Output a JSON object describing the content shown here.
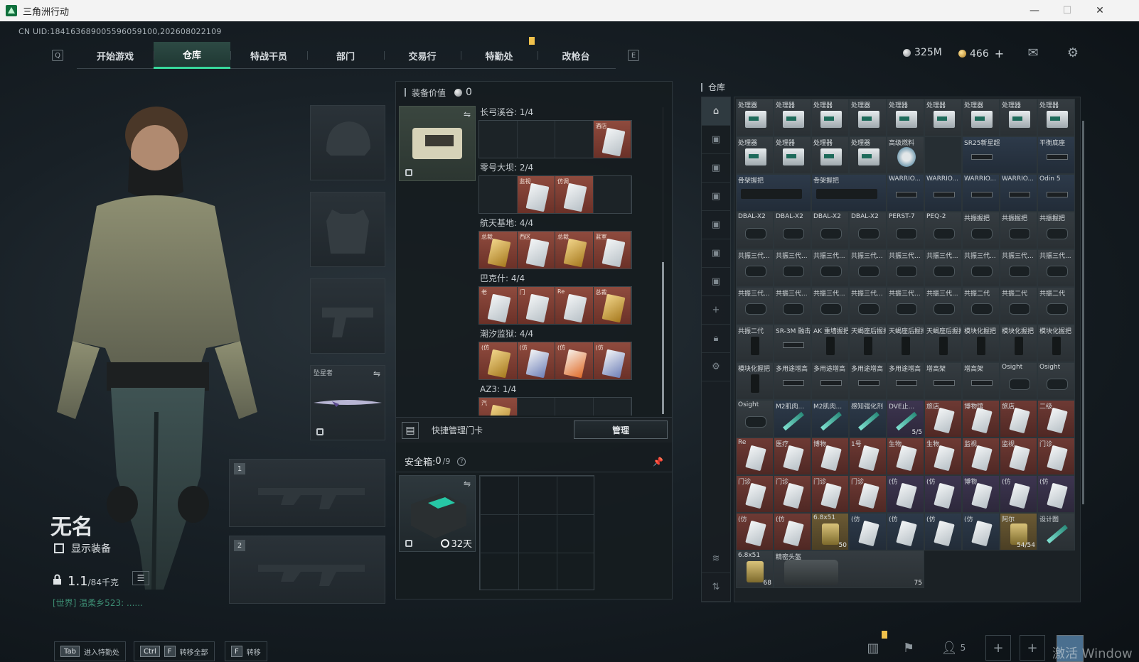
{
  "window": {
    "title": "三角洲行动",
    "minimize": "—",
    "maximize": "☐",
    "close": "✕"
  },
  "uid": "CN UID:184163689005596059100,202608022109",
  "nav": {
    "left_key": "Q",
    "right_key": "E",
    "tabs": [
      "开始游戏",
      "仓库",
      "特战干员",
      "部门",
      "交易行",
      "特勤处",
      "改枪台"
    ],
    "active_tab": "仓库"
  },
  "currency": {
    "silver": "325M",
    "gold": "466",
    "gold_add": "+"
  },
  "player": {
    "name": "无名",
    "show_equipment": "显示装备",
    "weight_value": "1.1",
    "weight_max": "/84千克",
    "chat": "[世界] 温柔乡523: ......"
  },
  "slots": {
    "melee_label": "坠星者",
    "primary_1": "1",
    "primary_2": "2"
  },
  "equipment": {
    "title": "装备价值",
    "value": "0",
    "maps": [
      {
        "label": "长弓溪谷: 1/4",
        "cells": [
          {
            "state": "empty"
          },
          {
            "state": "empty"
          },
          {
            "state": "empty"
          },
          {
            "state": "filled",
            "cap": "酒店",
            "tint": "white"
          }
        ]
      },
      {
        "label": "零号大坝: 2/4",
        "cells": [
          {
            "state": "empty"
          },
          {
            "state": "filled",
            "cap": "监视",
            "tint": "white"
          },
          {
            "state": "filled",
            "cap": "仿调",
            "tint": "white"
          },
          {
            "state": "empty"
          }
        ]
      },
      {
        "label": "航天基地: 4/4",
        "cells": [
          {
            "state": "filled",
            "cap": "总裁",
            "tint": "gold"
          },
          {
            "state": "filled",
            "cap": "西区",
            "tint": "white"
          },
          {
            "state": "filled",
            "cap": "总裁",
            "tint": "gold"
          },
          {
            "state": "filled",
            "cap": "蓝室",
            "tint": "white"
          }
        ]
      },
      {
        "label": "巴克什: 4/4",
        "cells": [
          {
            "state": "filled",
            "cap": "老",
            "tint": "white"
          },
          {
            "state": "filled",
            "cap": "门",
            "tint": "white"
          },
          {
            "state": "filled",
            "cap": "Re",
            "tint": "white"
          },
          {
            "state": "filled",
            "cap": "总裁",
            "tint": "gold"
          }
        ]
      },
      {
        "label": "潮汐监狱: 4/4",
        "cells": [
          {
            "state": "filled",
            "cap": "(仿",
            "tint": "gold"
          },
          {
            "state": "filled",
            "cap": "(仿",
            "tint": "blue"
          },
          {
            "state": "filled",
            "cap": "(仿",
            "tint": "orange"
          },
          {
            "state": "filled",
            "cap": "(仿",
            "tint": "blue"
          }
        ]
      },
      {
        "label": "AZ3: 1/4",
        "cells": [
          {
            "state": "filled",
            "cap": "汽",
            "tint": "gold"
          },
          {
            "state": "empty"
          },
          {
            "state": "empty"
          },
          {
            "state": "empty"
          }
        ]
      }
    ],
    "quick_card_label": "快捷管理门卡",
    "manage_button": "管理",
    "safebox_label": "安全箱: ",
    "safebox_count": "0",
    "safebox_max": "/9",
    "safebox_help": "?",
    "safebox_days": "32天"
  },
  "warehouse": {
    "title": "仓库",
    "items": [
      {
        "nm": "处理器",
        "g": "box",
        "c": "gray"
      },
      {
        "nm": "处理器",
        "g": "box",
        "c": "gray"
      },
      {
        "nm": "处理器",
        "g": "box",
        "c": "gray"
      },
      {
        "nm": "处理器",
        "g": "box",
        "c": "gray"
      },
      {
        "nm": "处理器",
        "g": "box",
        "c": "gray"
      },
      {
        "nm": "处理器",
        "g": "box",
        "c": "gray"
      },
      {
        "nm": "处理器",
        "g": "box",
        "c": "gray"
      },
      {
        "nm": "处理器",
        "g": "box",
        "c": "gray"
      },
      {
        "nm": "处理器",
        "g": "box",
        "c": "gray"
      },
      {
        "nm": "处理器",
        "g": "box",
        "c": "gray"
      },
      {
        "nm": "处理器",
        "g": "box",
        "c": "gray"
      },
      {
        "nm": "处理器",
        "g": "box",
        "c": "gray"
      },
      {
        "nm": "处理器",
        "g": "box",
        "c": "gray"
      },
      {
        "nm": "高级燃料",
        "g": "fuel",
        "c": "gray"
      },
      {
        "nm": "",
        "g": "",
        "c": ""
      },
      {
        "nm": "SR25新星超长枪管",
        "g": "rail",
        "c": "blue",
        "span": 2
      },
      {
        "nm": "平衡底座",
        "g": "rail",
        "c": "blue"
      },
      {
        "nm": "骨架握把",
        "g": "rifle",
        "c": "blue",
        "span": 2
      },
      {
        "nm": "骨架握把",
        "g": "rifle",
        "c": "blue",
        "span": 2
      },
      {
        "nm": "WARRIO...",
        "g": "rail",
        "c": "blue"
      },
      {
        "nm": "WARRIO...",
        "g": "rail",
        "c": "blue"
      },
      {
        "nm": "WARRIO...",
        "g": "rail",
        "c": "blue"
      },
      {
        "nm": "WARRIO...",
        "g": "rail",
        "c": "blue"
      },
      {
        "nm": "Odin 5",
        "g": "rail",
        "c": "blue"
      },
      {
        "nm": "DBAL-X2",
        "g": "scope",
        "c": "gray"
      },
      {
        "nm": "DBAL-X2",
        "g": "scope",
        "c": "gray"
      },
      {
        "nm": "DBAL-X2",
        "g": "scope",
        "c": "gray"
      },
      {
        "nm": "DBAL-X2",
        "g": "scope",
        "c": "gray"
      },
      {
        "nm": "PERST-7",
        "g": "scope",
        "c": "gray"
      },
      {
        "nm": "PEQ-2",
        "g": "scope",
        "c": "gray"
      },
      {
        "nm": "共振握把",
        "g": "scope",
        "c": "gray"
      },
      {
        "nm": "共振握把",
        "g": "scope",
        "c": "gray"
      },
      {
        "nm": "共振握把",
        "g": "scope",
        "c": "gray"
      },
      {
        "nm": "共振三代...",
        "g": "scope",
        "c": "gray"
      },
      {
        "nm": "共振三代...",
        "g": "scope",
        "c": "gray"
      },
      {
        "nm": "共振三代...",
        "g": "scope",
        "c": "gray"
      },
      {
        "nm": "共振三代...",
        "g": "scope",
        "c": "gray"
      },
      {
        "nm": "共振三代...",
        "g": "scope",
        "c": "gray"
      },
      {
        "nm": "共振三代...",
        "g": "scope",
        "c": "gray"
      },
      {
        "nm": "共振三代...",
        "g": "scope",
        "c": "gray"
      },
      {
        "nm": "共振三代...",
        "g": "scope",
        "c": "gray"
      },
      {
        "nm": "共振三代...",
        "g": "scope",
        "c": "gray"
      },
      {
        "nm": "共振三代...",
        "g": "scope",
        "c": "gray"
      },
      {
        "nm": "共振三代...",
        "g": "scope",
        "c": "gray"
      },
      {
        "nm": "共振三代...",
        "g": "scope",
        "c": "gray"
      },
      {
        "nm": "共振三代...",
        "g": "scope",
        "c": "gray"
      },
      {
        "nm": "共振三代...",
        "g": "scope",
        "c": "gray"
      },
      {
        "nm": "共振三代...",
        "g": "scope",
        "c": "gray"
      },
      {
        "nm": "共振二代",
        "g": "scope",
        "c": "gray"
      },
      {
        "nm": "共振二代",
        "g": "scope",
        "c": "gray"
      },
      {
        "nm": "共振二代",
        "g": "scope",
        "c": "gray"
      },
      {
        "nm": "共振二代",
        "g": "grip",
        "c": "gray"
      },
      {
        "nm": "SR-3M 融击消音器",
        "g": "rail",
        "c": "gray"
      },
      {
        "nm": "AK 重墙握把",
        "g": "grip",
        "c": "gray"
      },
      {
        "nm": "天蝎座后握把",
        "g": "grip",
        "c": "gray"
      },
      {
        "nm": "天蝎座后握把",
        "g": "grip",
        "c": "gray"
      },
      {
        "nm": "天蝎座后握把",
        "g": "grip",
        "c": "gray"
      },
      {
        "nm": "模块化握把",
        "g": "grip",
        "c": "gray"
      },
      {
        "nm": "模块化握把",
        "g": "grip",
        "c": "gray"
      },
      {
        "nm": "模块化握把",
        "g": "grip",
        "c": "gray"
      },
      {
        "nm": "模块化握把",
        "g": "grip",
        "c": "gray"
      },
      {
        "nm": "多用途增高",
        "g": "rail",
        "c": "gray"
      },
      {
        "nm": "多用途增高",
        "g": "rail",
        "c": "gray"
      },
      {
        "nm": "多用途增高",
        "g": "rail",
        "c": "gray"
      },
      {
        "nm": "多用途增高",
        "g": "rail",
        "c": "gray"
      },
      {
        "nm": "增高架",
        "g": "rail",
        "c": "gray"
      },
      {
        "nm": "增高架",
        "g": "rail",
        "c": "gray"
      },
      {
        "nm": "Osight",
        "g": "scope",
        "c": "gray"
      },
      {
        "nm": "Osight",
        "g": "scope",
        "c": "gray"
      },
      {
        "nm": "Osight",
        "g": "scope",
        "c": "gray"
      },
      {
        "nm": "M2肌肉...",
        "g": "syringe",
        "c": "blue"
      },
      {
        "nm": "M2肌肉...",
        "g": "syringe",
        "c": "blue"
      },
      {
        "nm": "感知强化剂",
        "g": "syringe",
        "c": "blue"
      },
      {
        "nm": "DVE止...",
        "g": "syringe",
        "c": "purple",
        "ct": "5/5"
      },
      {
        "nm": "旅店",
        "g": "card",
        "c": "red"
      },
      {
        "nm": "博物馆",
        "g": "card",
        "c": "red"
      },
      {
        "nm": "旅店",
        "g": "card",
        "c": "red"
      },
      {
        "nm": "二级",
        "g": "card",
        "c": "red"
      },
      {
        "nm": "Re",
        "g": "card",
        "c": "red"
      },
      {
        "nm": "医疗",
        "g": "card",
        "c": "red"
      },
      {
        "nm": "博物",
        "g": "card",
        "c": "red"
      },
      {
        "nm": "1号",
        "g": "card",
        "c": "red"
      },
      {
        "nm": "生物",
        "g": "card",
        "c": "red"
      },
      {
        "nm": "生物",
        "g": "card",
        "c": "red"
      },
      {
        "nm": "监视",
        "g": "card",
        "c": "red"
      },
      {
        "nm": "监视",
        "g": "card",
        "c": "red"
      },
      {
        "nm": "门诊",
        "g": "card",
        "c": "red"
      },
      {
        "nm": "门诊",
        "g": "card",
        "c": "red"
      },
      {
        "nm": "门诊",
        "g": "card",
        "c": "red"
      },
      {
        "nm": "门诊",
        "g": "card",
        "c": "red"
      },
      {
        "nm": "门诊",
        "g": "card",
        "c": "red"
      },
      {
        "nm": "(仿",
        "g": "card",
        "c": "purple"
      },
      {
        "nm": "(仿",
        "g": "card",
        "c": "purple"
      },
      {
        "nm": "博物",
        "g": "card",
        "c": "purple"
      },
      {
        "nm": "(仿",
        "g": "card",
        "c": "purple"
      },
      {
        "nm": "(仿",
        "g": "card",
        "c": "purple"
      },
      {
        "nm": "(仿",
        "g": "card",
        "c": "red"
      },
      {
        "nm": "(仿",
        "g": "card",
        "c": "red"
      },
      {
        "nm": "6.8x51",
        "g": "ammo",
        "c": "gold",
        "ct": "50"
      },
      {
        "nm": "(仿",
        "g": "card",
        "c": "blue"
      },
      {
        "nm": "(仿",
        "g": "card",
        "c": "blue"
      },
      {
        "nm": "(仿",
        "g": "card",
        "c": "blue"
      },
      {
        "nm": "(仿",
        "g": "card",
        "c": "blue"
      },
      {
        "nm": "阿尔",
        "g": "ammo",
        "c": "gold",
        "ct": "54/54"
      },
      {
        "nm": "设计图",
        "g": "syringe",
        "c": "gray"
      },
      {
        "nm": "6.8x51",
        "g": "ammo",
        "c": "gray",
        "ct": "68"
      },
      {
        "nm": "精密头盔",
        "g": "bag",
        "c": "gray",
        "span": 4,
        "ct": "75"
      }
    ]
  },
  "bottom": {
    "hint1_key": "Tab",
    "hint1_label": "进入特勤处",
    "hint2_key1": "Ctrl",
    "hint2_key2": "F",
    "hint2_label": "转移全部",
    "hint3_key": "F",
    "hint3_label": "转移",
    "team_count": "5",
    "watermark": "激活 Window"
  }
}
